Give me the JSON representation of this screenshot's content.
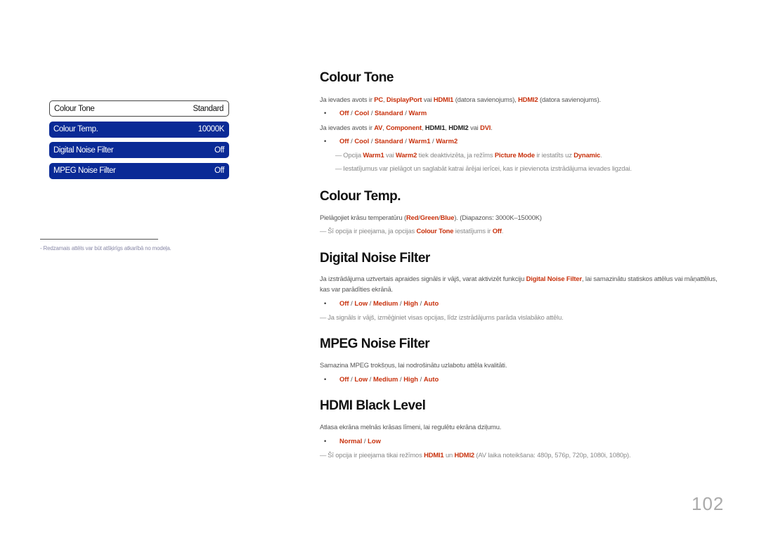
{
  "osd_menu": {
    "items": [
      {
        "label": "Colour Tone",
        "value": "Standard",
        "selected": true
      },
      {
        "label": "Colour Temp.",
        "value": "10000K",
        "selected": false
      },
      {
        "label": "Digital Noise Filter",
        "value": "Off",
        "selected": false
      },
      {
        "label": "MPEG Noise Filter",
        "value": "Off",
        "selected": false
      }
    ]
  },
  "footnote": "-  Redzamais attēls var būt atšķirīgs atkarībā no modeļa.",
  "colors": {
    "accent": "#c8310c",
    "menu_bg": "#0a2a96"
  },
  "sections": {
    "colour_tone": {
      "title": "Colour Tone",
      "line1": [
        "Ja ievades avots ir ",
        "PC",
        ", ",
        "DisplayPort",
        " vai ",
        "HDMI1",
        " (datora savienojums), ",
        "HDMI2",
        " (datora savienojums)."
      ],
      "options1": [
        "Off",
        "Cool",
        "Standard",
        "Warm"
      ],
      "line2": [
        "Ja ievades avots ir ",
        "AV",
        ", ",
        "Component",
        ", ",
        "HDMI1",
        ", ",
        "HDMI2",
        "  vai ",
        "DVI",
        "."
      ],
      "options2": [
        "Off",
        "Cool",
        "Standard",
        "Warm1",
        "Warm2"
      ],
      "note1": [
        "Opcija ",
        "Warm1",
        " vai ",
        "Warm2",
        " tiek deaktivizēta, ja režīms ",
        "Picture Mode",
        " ir iestatīts uz ",
        "Dynamic",
        "."
      ],
      "note2": "Iestatījumus var pielāgot un saglabāt katrai ārējai ierīcei, kas ir pievienota izstrādājuma ievades ligzdai."
    },
    "colour_temp": {
      "title": "Colour Temp.",
      "line1": [
        "Pielāgojiet krāsu temperatūru (",
        "Red",
        "/",
        "Green",
        "/",
        "Blue",
        "). (Diapazons: 3000K–15000K)"
      ],
      "note1": [
        "Šī opcija ir pieejama, ja opcijas ",
        "Colour Tone",
        " iestatījums ir ",
        "Off",
        "."
      ]
    },
    "digital_noise": {
      "title": "Digital Noise Filter",
      "line1": [
        "Ja izstrādājuma uztvertais apraides signāls ir vājš, varat aktivizēt funkciju ",
        "Digital Noise Filter",
        ", lai samazinātu statiskos attēlus vai māņattēlus, kas var parādīties ekrānā."
      ],
      "options": [
        "Off",
        "Low",
        "Medium",
        "High",
        "Auto"
      ],
      "note1": "Ja signāls ir vājš, izmēģiniet visas opcijas, līdz izstrādājums parāda vislabāko attēlu."
    },
    "mpeg_noise": {
      "title": "MPEG Noise Filter",
      "line1": "Samazina MPEG trokšņus, lai nodrošinātu uzlabotu attēla kvalitāti.",
      "options": [
        "Off",
        "Low",
        "Medium",
        "High",
        "Auto"
      ]
    },
    "hdmi_black": {
      "title": "HDMI Black Level",
      "line1": "Atlasa ekrāna melnās krāsas līmeni, lai regulētu ekrāna dziļumu.",
      "options": [
        "Normal",
        "Low"
      ],
      "note1": [
        "Šī opcija ir pieejama tikai režīmos ",
        "HDMI1",
        " un ",
        "HDMI2",
        " (AV laika noteikšana: 480p, 576p, 720p, 1080i, 1080p)."
      ]
    }
  },
  "bullet_glyph": "•",
  "note_glyph": "—",
  "separator": " / ",
  "page_number": "102"
}
